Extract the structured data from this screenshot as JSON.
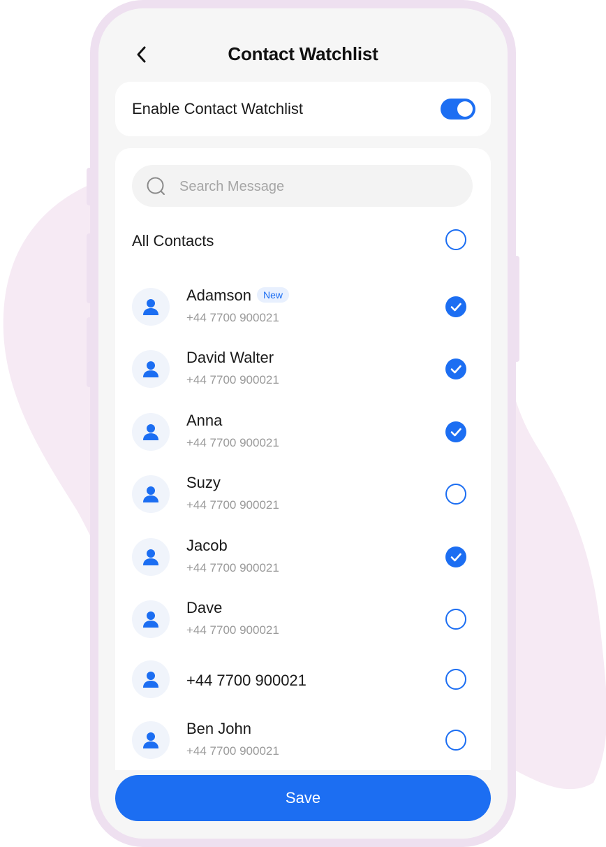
{
  "header": {
    "title": "Contact Watchlist"
  },
  "watchlist_toggle": {
    "label": "Enable Contact Watchlist",
    "enabled": true
  },
  "search": {
    "placeholder": "Search Message"
  },
  "all_contacts": {
    "label": "All Contacts",
    "selected": false
  },
  "contacts": [
    {
      "name": "Adamson",
      "badge": "New",
      "phone": "+44 7700 900021",
      "selected": true
    },
    {
      "name": "David Walter",
      "phone": "+44 7700 900021",
      "selected": true
    },
    {
      "name": "Anna",
      "phone": "+44 7700 900021",
      "selected": true
    },
    {
      "name": "Suzy",
      "phone": "+44 7700 900021",
      "selected": false
    },
    {
      "name": "Jacob",
      "phone": "+44 7700 900021",
      "selected": true
    },
    {
      "name": "Dave",
      "phone": "+44 7700 900021",
      "selected": false
    },
    {
      "number_only": "+44 7700 900021",
      "selected": false
    },
    {
      "name": "Ben John",
      "phone": "+44 7700 900021",
      "selected": false
    }
  ],
  "footer": {
    "save_label": "Save"
  },
  "colors": {
    "accent": "#1c6ef2",
    "phone_frame": "#eee0f0",
    "background_blob": "#f6eaf4"
  },
  "icons": {
    "back": "chevron-left-icon",
    "search": "search-icon",
    "avatar": "person-icon",
    "check": "check-icon"
  }
}
